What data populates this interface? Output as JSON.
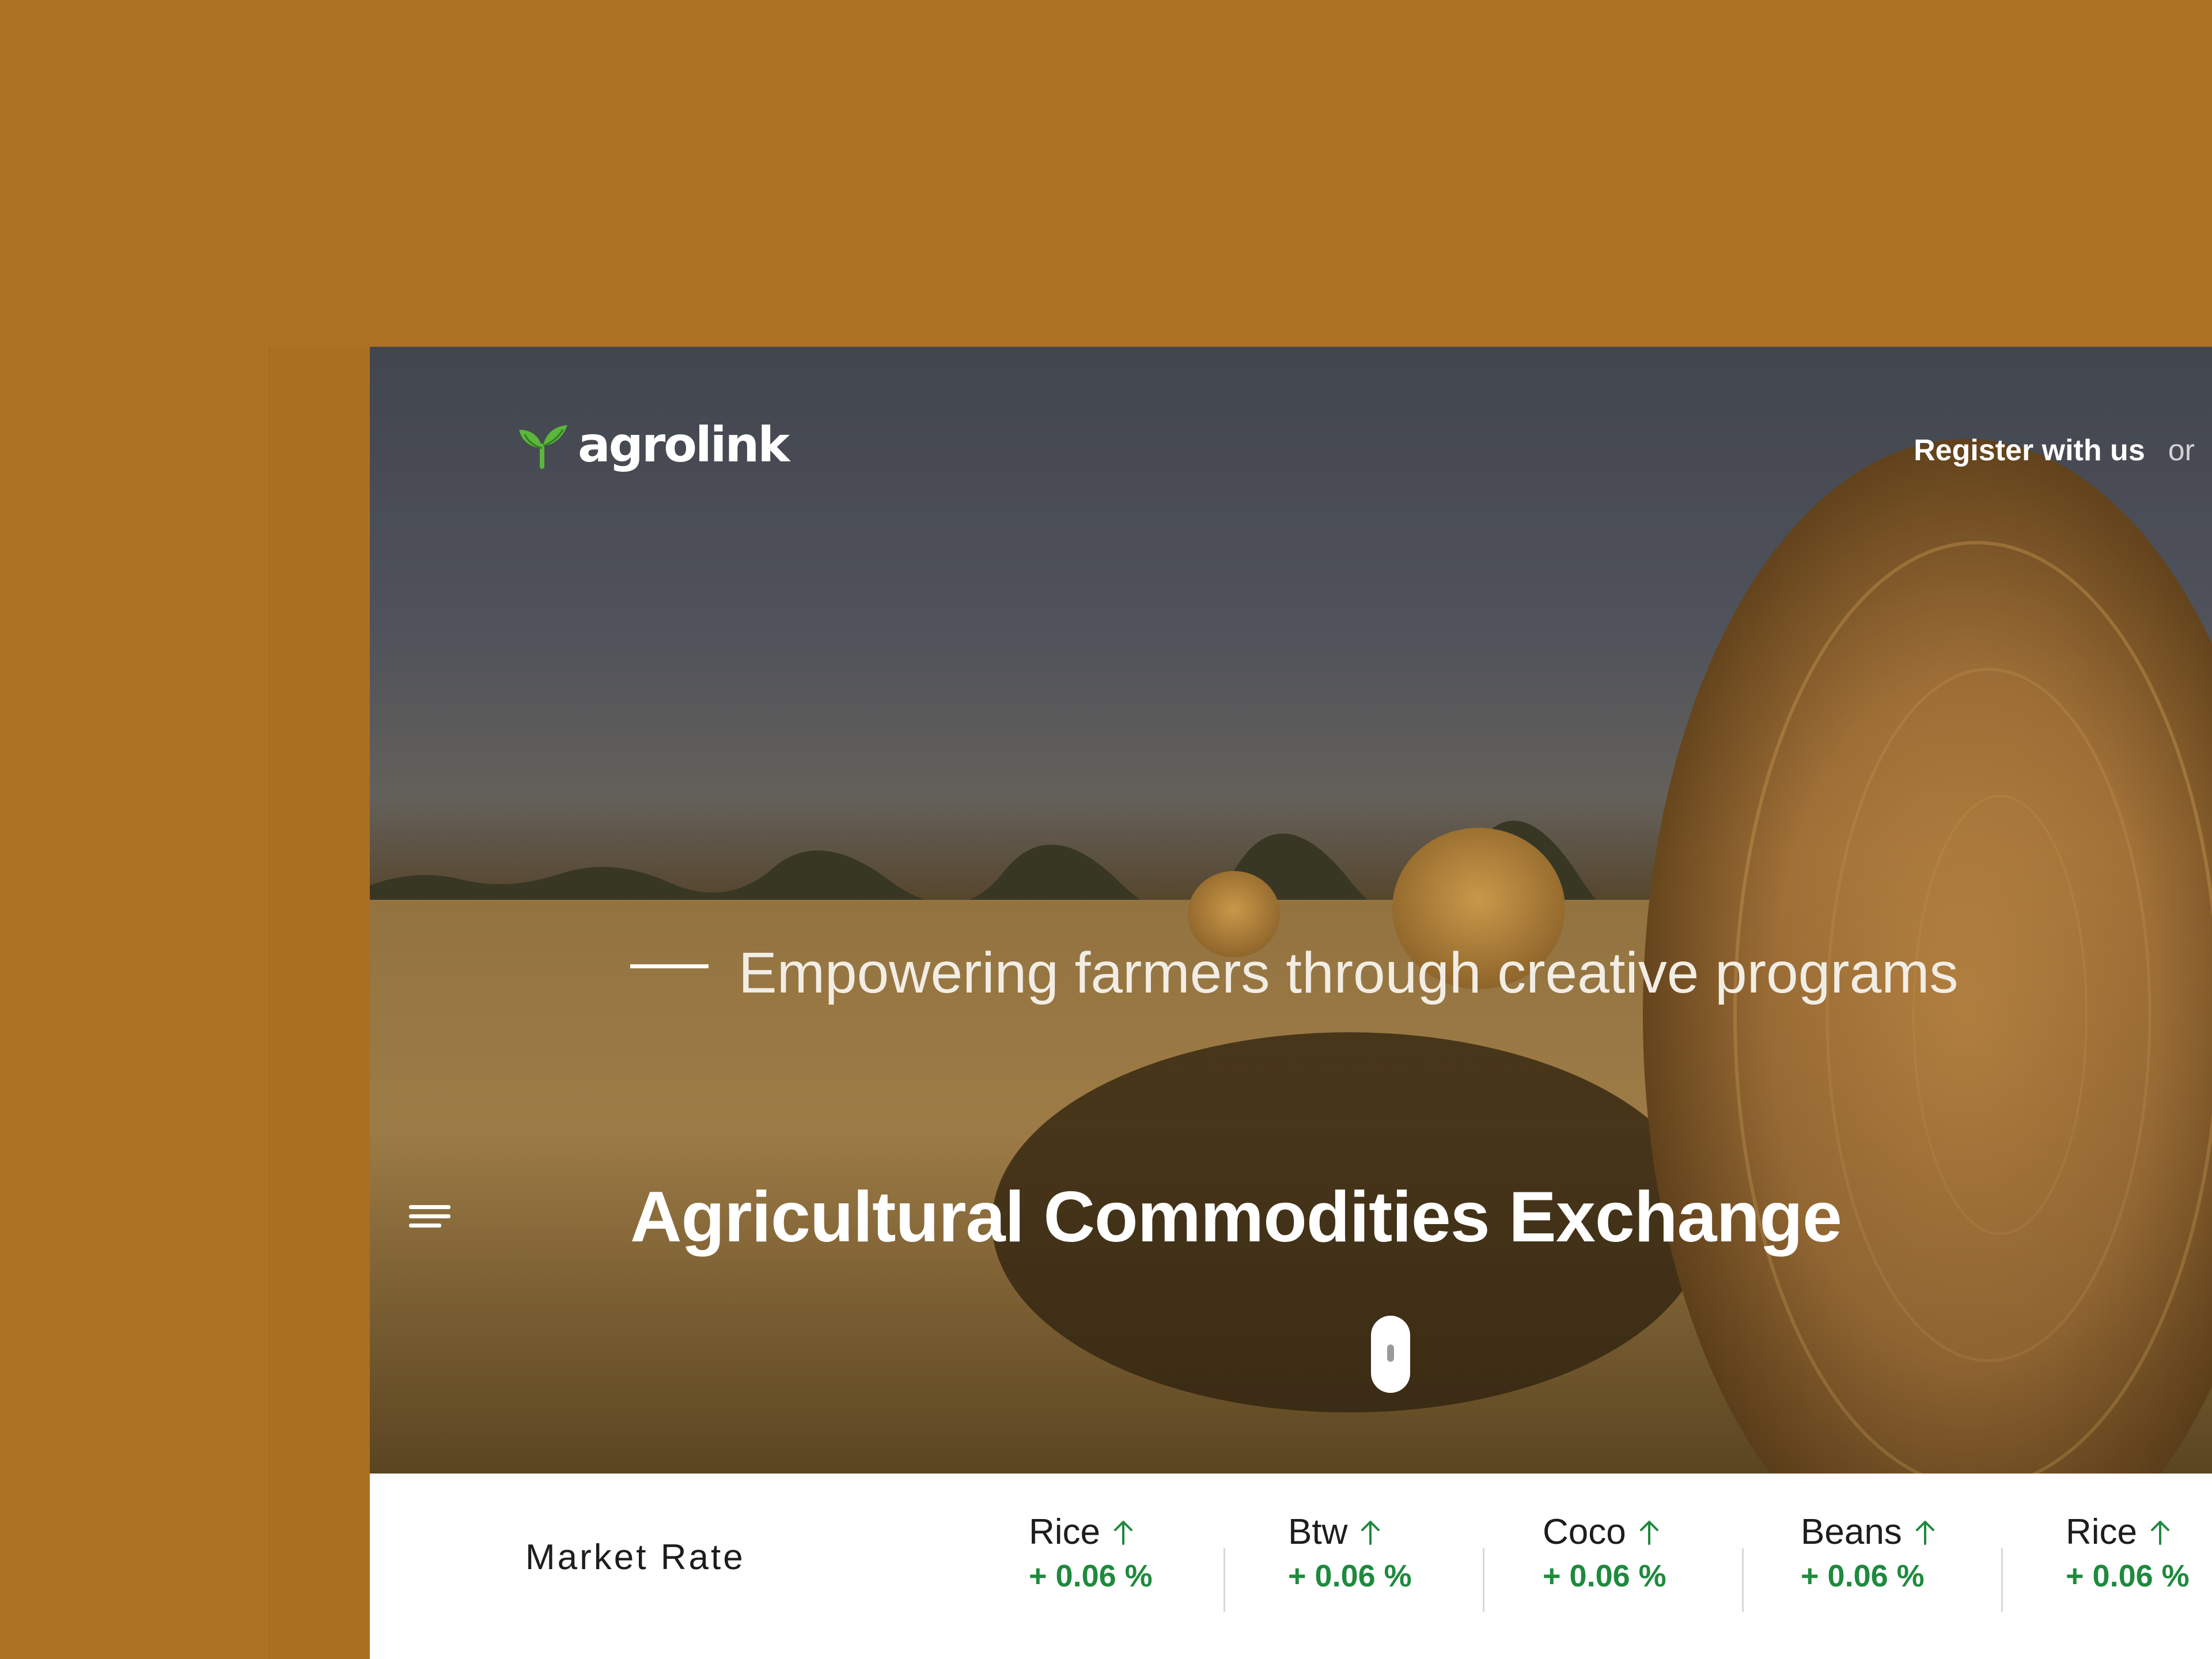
{
  "header": {
    "logo_text": "agrolink",
    "register_label": "Register with us",
    "or_label": "or"
  },
  "hero": {
    "title": "Agricultural Commodities Exchange",
    "subtitle": "Empowering farmers through creative programs"
  },
  "market": {
    "heading": "Market Rate",
    "items": [
      {
        "name": "Rice",
        "change": "+ 0.06 %",
        "trend": "up-arrow-icon"
      },
      {
        "name": "Btw",
        "change": "+ 0.06 %",
        "trend": "up-arrow-icon"
      },
      {
        "name": "Coco",
        "change": "+ 0.06 %",
        "trend": "up-arrow-icon"
      },
      {
        "name": "Beans",
        "change": "+ 0.06 %",
        "trend": "up-arrow-icon"
      },
      {
        "name": "Rice",
        "change": "+ 0.06 %",
        "trend": "up-arrow-icon"
      }
    ]
  },
  "colors": {
    "backdrop": "#ad7123",
    "accent_green": "#1e8a3d",
    "logo_green": "#5ab63c"
  }
}
